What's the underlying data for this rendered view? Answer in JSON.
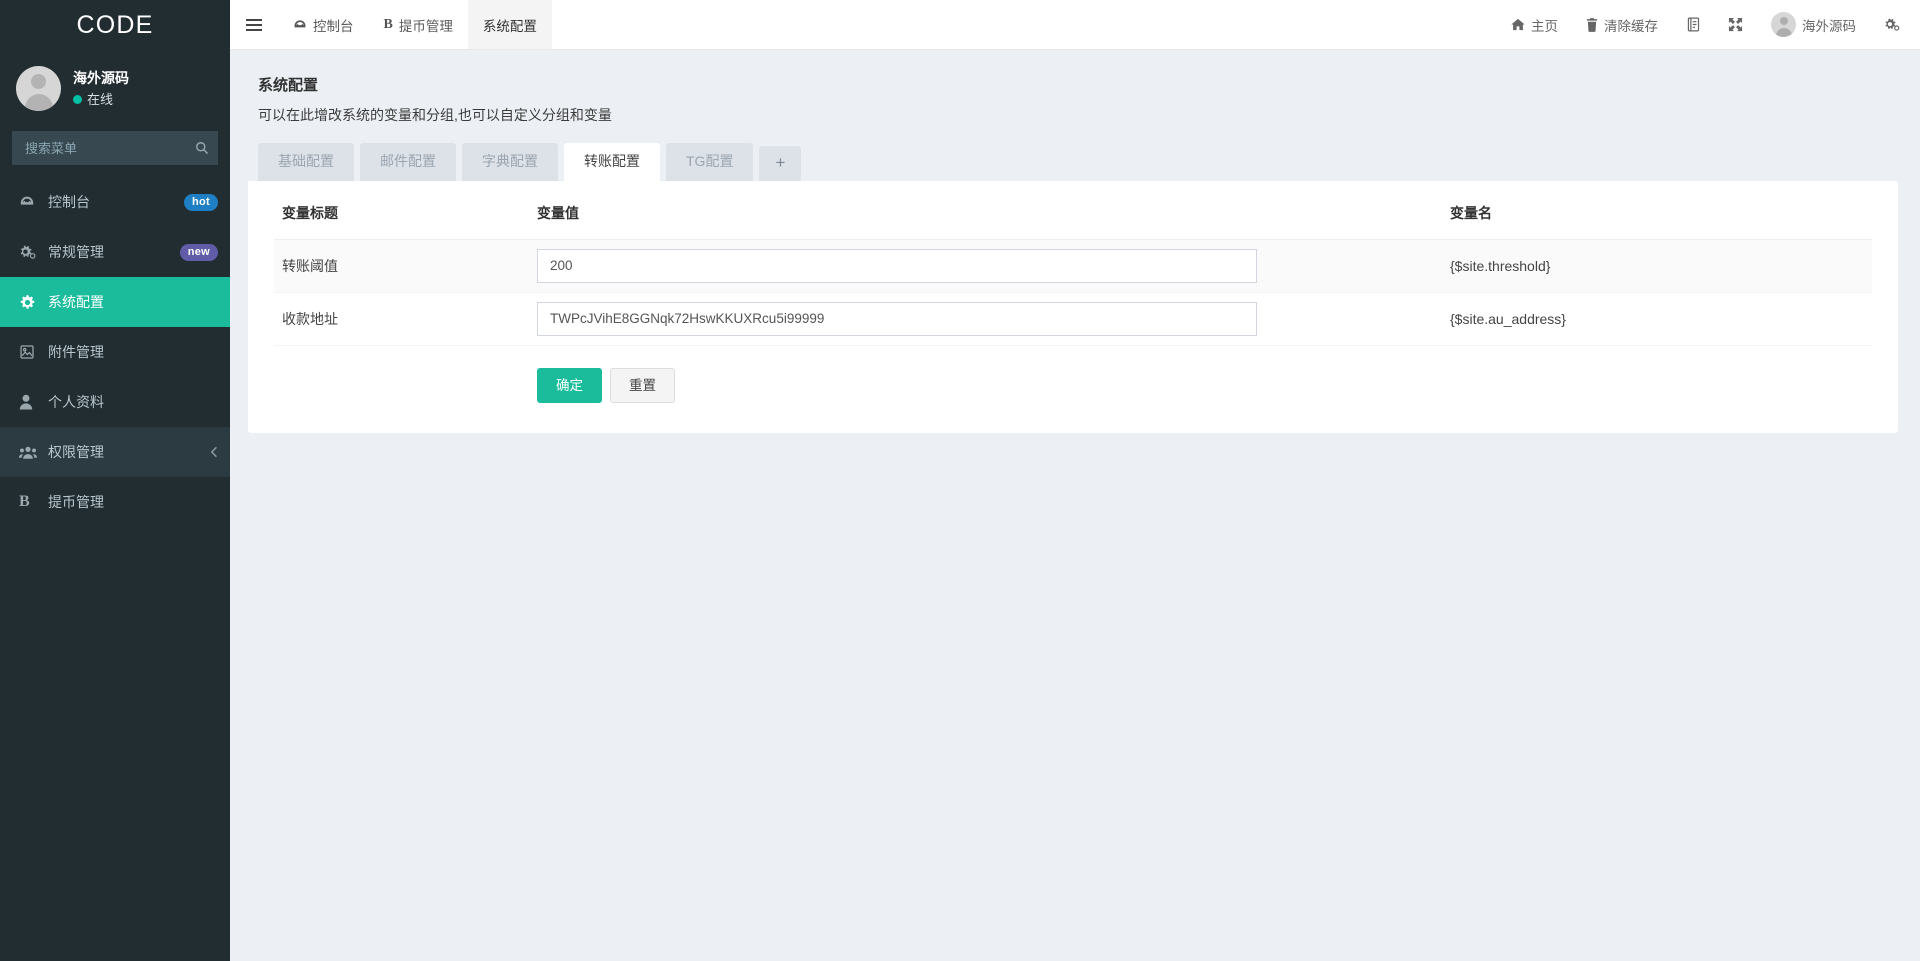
{
  "brand": {
    "logo_text": "CODE"
  },
  "sidebar": {
    "user": {
      "name": "海外源码",
      "status": "在线",
      "avatar_icon": "user-avatar-icon"
    },
    "search": {
      "placeholder": "搜索菜单",
      "icon": "search-icon"
    },
    "items": [
      {
        "label": "控制台",
        "icon": "dashboard-icon",
        "badge": "hot",
        "badge_color": "#1f7fc4",
        "active": false,
        "state": "normal"
      },
      {
        "label": "常规管理",
        "icon": "cogs-icon",
        "badge": "new",
        "badge_color": "#605ca8",
        "active": false,
        "state": "normal"
      },
      {
        "label": "系统配置",
        "icon": "gear-icon",
        "badge": "",
        "badge_color": "",
        "active": true,
        "state": "active"
      },
      {
        "label": "附件管理",
        "icon": "image-file-icon",
        "badge": "",
        "badge_color": "",
        "active": false,
        "state": "normal"
      },
      {
        "label": "个人资料",
        "icon": "user-icon",
        "badge": "",
        "badge_color": "",
        "active": false,
        "state": "normal"
      },
      {
        "label": "权限管理",
        "icon": "users-icon",
        "badge": "",
        "badge_color": "",
        "active": false,
        "state": "semi",
        "caret": "chevron-left-icon"
      },
      {
        "label": "提币管理",
        "icon": "bitcoin-b-icon",
        "badge": "",
        "badge_color": "",
        "active": false,
        "state": "normal"
      }
    ]
  },
  "topnav": {
    "menu_toggle_icon": "hamburger-icon",
    "tabs": [
      {
        "label": "控制台",
        "icon": "dashboard-icon",
        "active": false
      },
      {
        "label": "提币管理",
        "icon": "bitcoin-b-icon",
        "active": false
      },
      {
        "label": "系统配置",
        "icon": "",
        "active": true
      }
    ],
    "actions": [
      {
        "label": "主页",
        "icon": "home-icon"
      },
      {
        "label": "清除缓存",
        "icon": "trash-icon"
      },
      {
        "label": "",
        "icon": "note-book-icon"
      },
      {
        "label": "",
        "icon": "fullscreen-icon"
      }
    ],
    "user": {
      "name": "海外源码",
      "avatar_icon": "user-avatar-icon"
    },
    "settings_icon": "gears-settings-icon"
  },
  "page": {
    "title": "系统配置",
    "description": "可以在此增改系统的变量和分组,也可以自定义分组和变量",
    "tabs": [
      {
        "label": "基础配置",
        "active": false
      },
      {
        "label": "邮件配置",
        "active": false
      },
      {
        "label": "字典配置",
        "active": false
      },
      {
        "label": "转账配置",
        "active": true
      },
      {
        "label": "TG配置",
        "active": false
      }
    ],
    "add_tab_label": "+"
  },
  "table": {
    "headers": {
      "title": "变量标题",
      "value": "变量值",
      "name": "变量名"
    },
    "rows": [
      {
        "title": "转账阈值",
        "value": "200",
        "name": "{$site.threshold}"
      },
      {
        "title": "收款地址",
        "value": "TWPcJVihE8GGNqk72HswKKUXRcu5i99999",
        "name": "{$site.au_address}"
      }
    ]
  },
  "buttons": {
    "submit": "确定",
    "reset": "重置"
  },
  "colors": {
    "accent": "#1abc9c",
    "sidebar_bg": "#222d32",
    "body_bg": "#ecf0f5",
    "badge_hot": "#1f7fc4",
    "badge_new": "#605ca8"
  }
}
